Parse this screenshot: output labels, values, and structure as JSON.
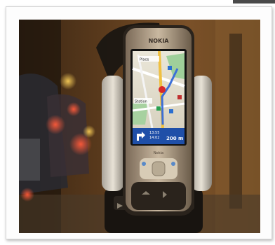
{
  "image": {
    "subject": "Nokia smartphone with map navigation mounted in car holder",
    "colors": {
      "frame": "#fdfdfd",
      "scene_dark": "#2b1d10",
      "scene_warm": "#8a5a2a",
      "screen_blue": "#1f4fa8"
    }
  },
  "phone": {
    "brand": "NOKIA",
    "model": "Nokia",
    "screen": {
      "map_label_top": "Place",
      "map_label_mid": "Station",
      "time": "13:55",
      "eta": "14:02",
      "distance": "200 m"
    }
  }
}
